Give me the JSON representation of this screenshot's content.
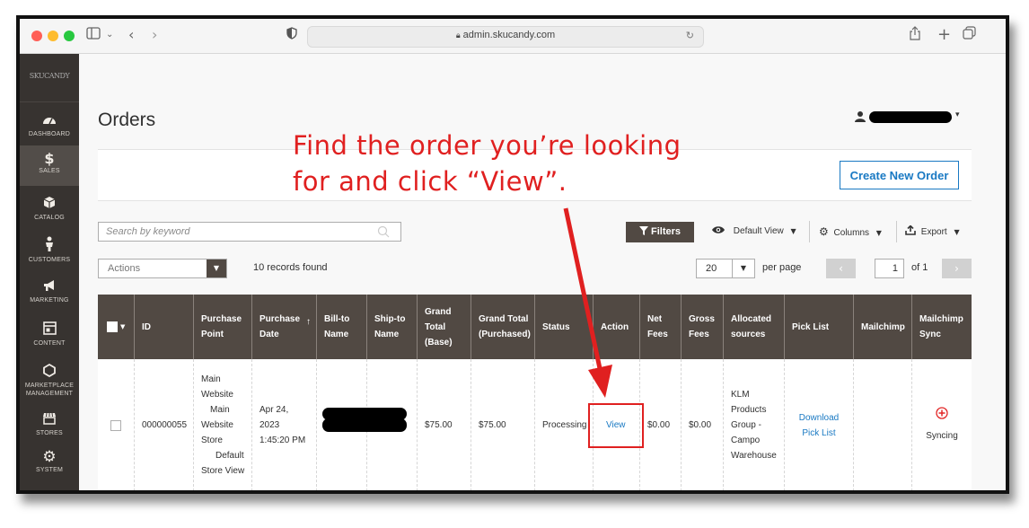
{
  "browser": {
    "url": "admin.skucandy.com",
    "traffic_lights": [
      "#ff5f57",
      "#febc2e",
      "#28c840"
    ]
  },
  "sidebar": {
    "logo": "SKUCANDY",
    "items": [
      {
        "label": "DASHBOARD",
        "icon": "dashboard-icon"
      },
      {
        "label": "SALES",
        "icon": "dollar-icon",
        "glyph": "$"
      },
      {
        "label": "CATALOG",
        "icon": "cube-icon"
      },
      {
        "label": "CUSTOMERS",
        "icon": "person-icon"
      },
      {
        "label": "MARKETING",
        "icon": "megaphone-icon"
      },
      {
        "label": "CONTENT",
        "icon": "layout-icon"
      },
      {
        "label": "MARKETPLACE MANAGEMENT",
        "label_l1": "MARKETPLACE",
        "label_l2": "MANAGEMENT",
        "icon": "hexagon-icon"
      },
      {
        "label": "STORES",
        "icon": "store-icon"
      },
      {
        "label": "SYSTEM",
        "icon": "gear-icon"
      }
    ]
  },
  "page": {
    "title": "Orders",
    "create_button": "Create New Order"
  },
  "annotation": {
    "line1": "Find the order you’re looking",
    "line2": "for and click “View”.",
    "color": "#e02020"
  },
  "toolbar": {
    "search_placeholder": "Search by keyword",
    "filters": "Filters",
    "default_view": "Default View",
    "columns": "Columns",
    "export": "Export",
    "actions": "Actions",
    "records_found": "10 records found",
    "per_page_value": "20",
    "per_page_label": "per page",
    "page_value": "1",
    "of_pages": "of 1"
  },
  "table": {
    "headers": {
      "id": "ID",
      "purchase_point": [
        "Purchase",
        "Point"
      ],
      "purchase_date": [
        "Purchase",
        "Date"
      ],
      "sort_arrow": "↑",
      "bill_to": [
        "Bill-to",
        "Name"
      ],
      "ship_to": [
        "Ship-to",
        "Name"
      ],
      "grand_total_base": [
        "Grand",
        "Total",
        "(Base)"
      ],
      "grand_total_purchased": [
        "Grand Total",
        "(Purchased)"
      ],
      "status": "Status",
      "action": "Action",
      "net_fees": [
        "Net",
        "Fees"
      ],
      "gross_fees": [
        "Gross",
        "Fees"
      ],
      "allocated_sources": [
        "Allocated",
        "sources"
      ],
      "pick_list": "Pick List",
      "mailchimp": "Mailchimp",
      "mailchimp_sync": [
        "Mailchimp",
        "Sync"
      ]
    },
    "row": {
      "id": "000000055",
      "purchase_point": [
        "Main",
        "Website",
        "Main",
        "Website",
        "Store",
        "Default",
        "Store View"
      ],
      "purchase_date": [
        "Apr 24,",
        "2023",
        "1:45:20 PM"
      ],
      "grand_total_base": "$75.00",
      "grand_total_purchased": "$75.00",
      "status": "Processing",
      "action": "View",
      "net_fees": "$0.00",
      "gross_fees": "$0.00",
      "allocated_sources": [
        "KLM",
        "Products",
        "Group -",
        "Campo",
        "Warehouse"
      ],
      "pick_list": [
        "Download",
        "Pick List"
      ],
      "mailchimp": "",
      "mailchimp_sync": "Syncing",
      "sync_icon": "plus-circle-icon"
    }
  },
  "colors": {
    "sidebar": "#373330",
    "header": "#514943",
    "link": "#1979c3",
    "annotation": "#e02020"
  }
}
